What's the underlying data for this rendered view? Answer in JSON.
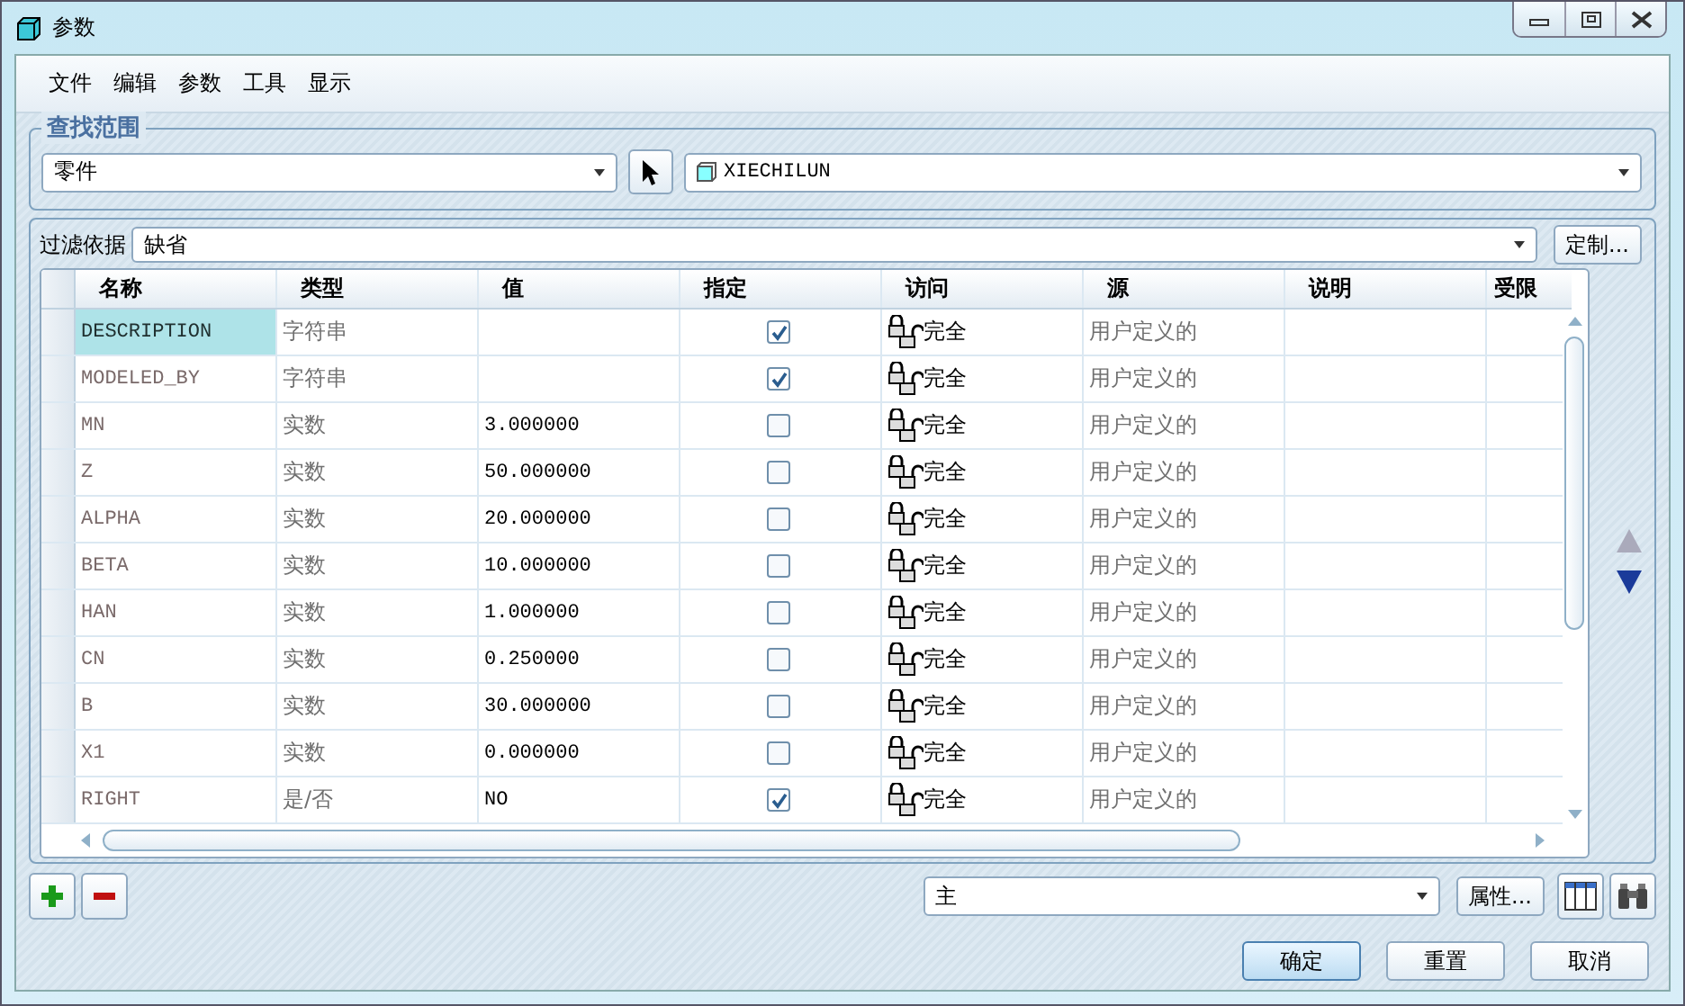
{
  "window": {
    "title": "参数"
  },
  "menu": [
    "文件",
    "编辑",
    "参数",
    "工具",
    "显示"
  ],
  "lookup": {
    "title": "查找范围",
    "scope": "零件",
    "model": "XIECHILUN"
  },
  "filter": {
    "label": "过滤依据",
    "value": "缺省",
    "button": "定制..."
  },
  "table": {
    "columns": [
      "名称",
      "类型",
      "值",
      "指定",
      "访问",
      "源",
      "说明",
      "受限"
    ],
    "rows": [
      {
        "name": "DESCRIPTION",
        "type": "字符串",
        "value": "",
        "designated": true,
        "access": "完全",
        "source": "用户定义的",
        "selected": true
      },
      {
        "name": "MODELED_BY",
        "type": "字符串",
        "value": "",
        "designated": true,
        "access": "完全",
        "source": "用户定义的",
        "selected": false
      },
      {
        "name": "MN",
        "type": "实数",
        "value": "3.000000",
        "designated": false,
        "access": "完全",
        "source": "用户定义的",
        "selected": false
      },
      {
        "name": "Z",
        "type": "实数",
        "value": "50.000000",
        "designated": false,
        "access": "完全",
        "source": "用户定义的",
        "selected": false
      },
      {
        "name": "ALPHA",
        "type": "实数",
        "value": "20.000000",
        "designated": false,
        "access": "完全",
        "source": "用户定义的",
        "selected": false
      },
      {
        "name": "BETA",
        "type": "实数",
        "value": "10.000000",
        "designated": false,
        "access": "完全",
        "source": "用户定义的",
        "selected": false
      },
      {
        "name": "HAN",
        "type": "实数",
        "value": "1.000000",
        "designated": false,
        "access": "完全",
        "source": "用户定义的",
        "selected": false
      },
      {
        "name": "CN",
        "type": "实数",
        "value": "0.250000",
        "designated": false,
        "access": "完全",
        "source": "用户定义的",
        "selected": false
      },
      {
        "name": "B",
        "type": "实数",
        "value": "30.000000",
        "designated": false,
        "access": "完全",
        "source": "用户定义的",
        "selected": false
      },
      {
        "name": "X1",
        "type": "实数",
        "value": "0.000000",
        "designated": false,
        "access": "完全",
        "source": "用户定义的",
        "selected": false
      },
      {
        "name": "RIGHT",
        "type": "是/否",
        "value": "NO",
        "designated": true,
        "access": "完全",
        "source": "用户定义的",
        "selected": false
      }
    ]
  },
  "bottom": {
    "set": "主",
    "properties": "属性..."
  },
  "buttons": [
    "确定",
    "重置",
    "取消"
  ]
}
